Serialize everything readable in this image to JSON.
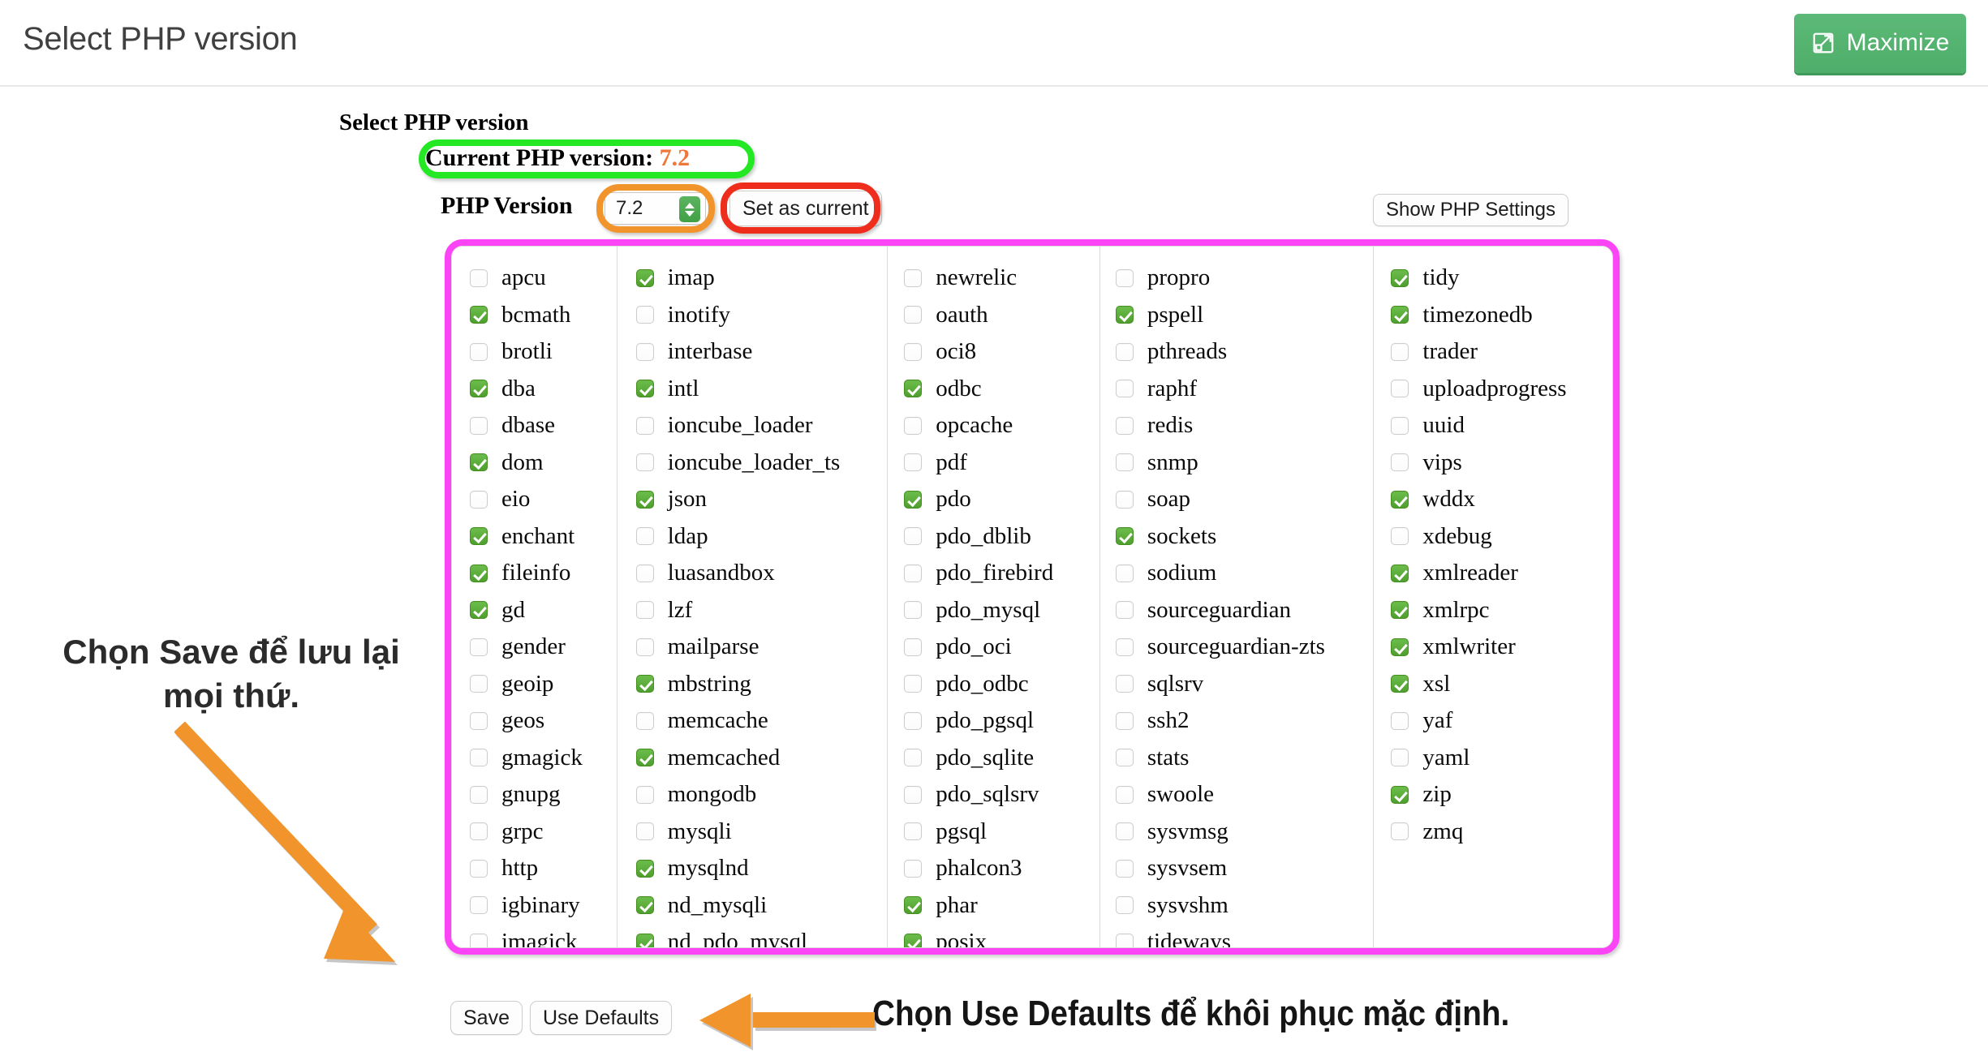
{
  "header": {
    "title": "Select PHP version",
    "maximize_label": "Maximize",
    "maximize_icon": "maximize-expand-icon",
    "maximize_color": "#51af6b"
  },
  "panel": {
    "heading": "Select PHP version",
    "current_version_label": "Current PHP version:",
    "current_version_value": "7.2",
    "current_version_value_color": "#f0763a",
    "php_version_label": "PHP Version",
    "php_version_selected": "7.2",
    "set_as_current_label": "Set as current",
    "show_php_settings_label": "Show PHP Settings",
    "save_label": "Save",
    "use_defaults_label": "Use Defaults"
  },
  "highlights": {
    "green_box_color": "#25e825",
    "orange_box_color": "#f2942c",
    "red_box_color": "#ef2d1c",
    "magenta_box_color": "#fa44f5",
    "arrow_color": "#f2942c"
  },
  "annotations": {
    "save_note": "Chọn Save để lưu lại mọi thứ.",
    "defaults_note": "Chọn Use Defaults để khôi phục mặc định."
  },
  "extensions": {
    "columns": [
      {
        "id": "col-1",
        "items": [
          {
            "name": "apcu",
            "checked": false
          },
          {
            "name": "bcmath",
            "checked": true
          },
          {
            "name": "brotli",
            "checked": false
          },
          {
            "name": "dba",
            "checked": true
          },
          {
            "name": "dbase",
            "checked": false
          },
          {
            "name": "dom",
            "checked": true
          },
          {
            "name": "eio",
            "checked": false
          },
          {
            "name": "enchant",
            "checked": true
          },
          {
            "name": "fileinfo",
            "checked": true
          },
          {
            "name": "gd",
            "checked": true
          },
          {
            "name": "gender",
            "checked": false
          },
          {
            "name": "geoip",
            "checked": false
          },
          {
            "name": "geos",
            "checked": false
          },
          {
            "name": "gmagick",
            "checked": false
          },
          {
            "name": "gnupg",
            "checked": false
          },
          {
            "name": "grpc",
            "checked": false
          },
          {
            "name": "http",
            "checked": false
          },
          {
            "name": "igbinary",
            "checked": false
          },
          {
            "name": "imagick",
            "checked": false
          }
        ]
      },
      {
        "id": "col-2",
        "items": [
          {
            "name": "imap",
            "checked": true
          },
          {
            "name": "inotify",
            "checked": false
          },
          {
            "name": "interbase",
            "checked": false
          },
          {
            "name": "intl",
            "checked": true
          },
          {
            "name": "ioncube_loader",
            "checked": false
          },
          {
            "name": "ioncube_loader_ts",
            "checked": false
          },
          {
            "name": "json",
            "checked": true
          },
          {
            "name": "ldap",
            "checked": false
          },
          {
            "name": "luasandbox",
            "checked": false
          },
          {
            "name": "lzf",
            "checked": false
          },
          {
            "name": "mailparse",
            "checked": false
          },
          {
            "name": "mbstring",
            "checked": true
          },
          {
            "name": "memcache",
            "checked": false
          },
          {
            "name": "memcached",
            "checked": true
          },
          {
            "name": "mongodb",
            "checked": false
          },
          {
            "name": "mysqli",
            "checked": false
          },
          {
            "name": "mysqlnd",
            "checked": true
          },
          {
            "name": "nd_mysqli",
            "checked": true
          },
          {
            "name": "nd_pdo_mysql",
            "checked": true
          }
        ]
      },
      {
        "id": "col-3",
        "items": [
          {
            "name": "newrelic",
            "checked": false
          },
          {
            "name": "oauth",
            "checked": false
          },
          {
            "name": "oci8",
            "checked": false
          },
          {
            "name": "odbc",
            "checked": true
          },
          {
            "name": "opcache",
            "checked": false
          },
          {
            "name": "pdf",
            "checked": false
          },
          {
            "name": "pdo",
            "checked": true
          },
          {
            "name": "pdo_dblib",
            "checked": false
          },
          {
            "name": "pdo_firebird",
            "checked": false
          },
          {
            "name": "pdo_mysql",
            "checked": false
          },
          {
            "name": "pdo_oci",
            "checked": false
          },
          {
            "name": "pdo_odbc",
            "checked": false
          },
          {
            "name": "pdo_pgsql",
            "checked": false
          },
          {
            "name": "pdo_sqlite",
            "checked": false
          },
          {
            "name": "pdo_sqlsrv",
            "checked": false
          },
          {
            "name": "pgsql",
            "checked": false
          },
          {
            "name": "phalcon3",
            "checked": false
          },
          {
            "name": "phar",
            "checked": true
          },
          {
            "name": "posix",
            "checked": true
          }
        ]
      },
      {
        "id": "col-4",
        "items": [
          {
            "name": "propro",
            "checked": false
          },
          {
            "name": "pspell",
            "checked": true
          },
          {
            "name": "pthreads",
            "checked": false
          },
          {
            "name": "raphf",
            "checked": false
          },
          {
            "name": "redis",
            "checked": false
          },
          {
            "name": "snmp",
            "checked": false
          },
          {
            "name": "soap",
            "checked": false
          },
          {
            "name": "sockets",
            "checked": true
          },
          {
            "name": "sodium",
            "checked": false
          },
          {
            "name": "sourceguardian",
            "checked": false
          },
          {
            "name": "sourceguardian-zts",
            "checked": false
          },
          {
            "name": "sqlsrv",
            "checked": false
          },
          {
            "name": "ssh2",
            "checked": false
          },
          {
            "name": "stats",
            "checked": false
          },
          {
            "name": "swoole",
            "checked": false
          },
          {
            "name": "sysvmsg",
            "checked": false
          },
          {
            "name": "sysvsem",
            "checked": false
          },
          {
            "name": "sysvshm",
            "checked": false
          },
          {
            "name": "tideways",
            "checked": false
          }
        ]
      },
      {
        "id": "col-5",
        "items": [
          {
            "name": "tidy",
            "checked": true
          },
          {
            "name": "timezonedb",
            "checked": true
          },
          {
            "name": "trader",
            "checked": false
          },
          {
            "name": "uploadprogress",
            "checked": false
          },
          {
            "name": "uuid",
            "checked": false
          },
          {
            "name": "vips",
            "checked": false
          },
          {
            "name": "wddx",
            "checked": true
          },
          {
            "name": "xdebug",
            "checked": false
          },
          {
            "name": "xmlreader",
            "checked": true
          },
          {
            "name": "xmlrpc",
            "checked": true
          },
          {
            "name": "xmlwriter",
            "checked": true
          },
          {
            "name": "xsl",
            "checked": true
          },
          {
            "name": "yaf",
            "checked": false
          },
          {
            "name": "yaml",
            "checked": false
          },
          {
            "name": "zip",
            "checked": true
          },
          {
            "name": "zmq",
            "checked": false
          }
        ]
      }
    ]
  }
}
